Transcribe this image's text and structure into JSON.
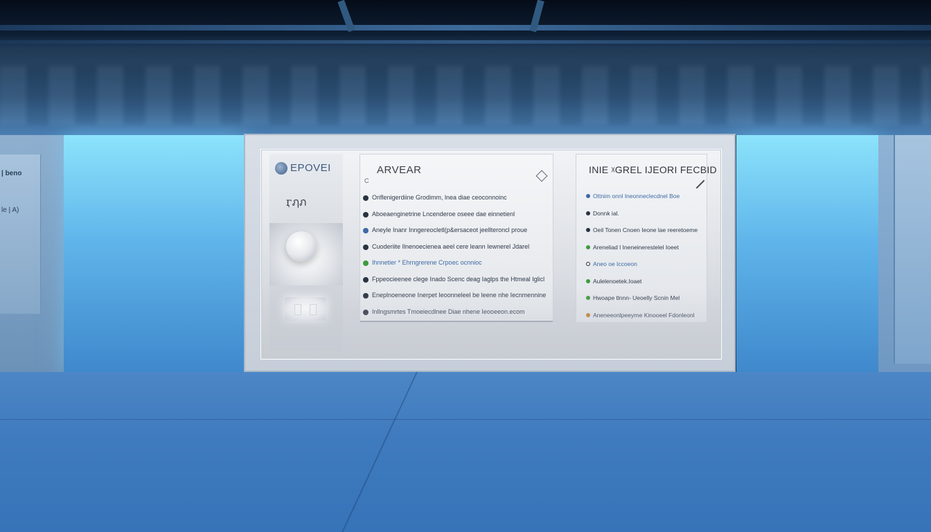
{
  "colors": {
    "accent": "#3e6aa5",
    "glow": "#8ce3fb",
    "floor": "#3f7bbe",
    "bullet_blue": "#3e6aa5",
    "bullet_green": "#3f9a3f",
    "bullet_dark": "#2a3340"
  },
  "left_side": {
    "line1": "| beno",
    "line2": "le | A)"
  },
  "board": {
    "brand": "EPOVEI",
    "brand_icon": "globe-icon",
    "brand_sub": "ӷฦภ",
    "middle": {
      "title": "ARVEAR",
      "subtitle": "C",
      "items": [
        {
          "text": "Oriflenigerdiine Grodimm, lnea diae ceoconnoinc",
          "bullet": "dark"
        },
        {
          "text": "Aboeaenginetrine Lncenderoe oseee dae einnetienl",
          "bullet": "dark"
        },
        {
          "text": "Aneyle Inanr Inngereocletl(p&ersaceot jeellteroncl proue",
          "bullet": "blue"
        },
        {
          "text": "Cuoderiite Ilnenoecienea aeel cere leann Iewnerel Jdarel",
          "bullet": "dark"
        },
        {
          "text": "Ihnnetier * Ehrngrerene Crpoec ocnnioc",
          "bullet": "green",
          "highlight": true
        },
        {
          "text": "Fppeocieenee clege Inado Scenc deag Iaglps the Htmeal Iglicl",
          "bullet": "dark"
        },
        {
          "text": "Eneplnoeneone Inerpet Ieoonneleel be leene nhe Iecnmennine",
          "bullet": "dark"
        },
        {
          "text": "Inllngsmrtes Tmoeiecdlnee Diae nhene Ieooeeon.ecom",
          "bullet": "dark"
        }
      ]
    },
    "right": {
      "title": "INIE ᵡGREL IJEORI FECBID",
      "items": [
        {
          "text": "Ottnim onnl Ineonneclecdnel Boe",
          "bullet": "blue",
          "highlight": true
        },
        {
          "text": "Donnk ial.",
          "bullet": "dark"
        },
        {
          "text": "Oeil Tonen Cnoen Ieone lae reeretoeme",
          "bullet": "dark"
        },
        {
          "text": "Areneliad l Ineneinerestelel Ioeet",
          "bullet": "green"
        },
        {
          "text": "Aneo oe Iccoeon",
          "bullet": "ring",
          "highlight": true
        },
        {
          "text": "Aulelenoetek.Ioaet",
          "bullet": "green"
        },
        {
          "text": "Hwoape tlnnn- Ueoelly Scnin Mel",
          "bullet": "green"
        },
        {
          "text": "Aneneeonlpeeyrne Kinooeel Fdonleonl",
          "bullet": "orange"
        }
      ]
    }
  }
}
